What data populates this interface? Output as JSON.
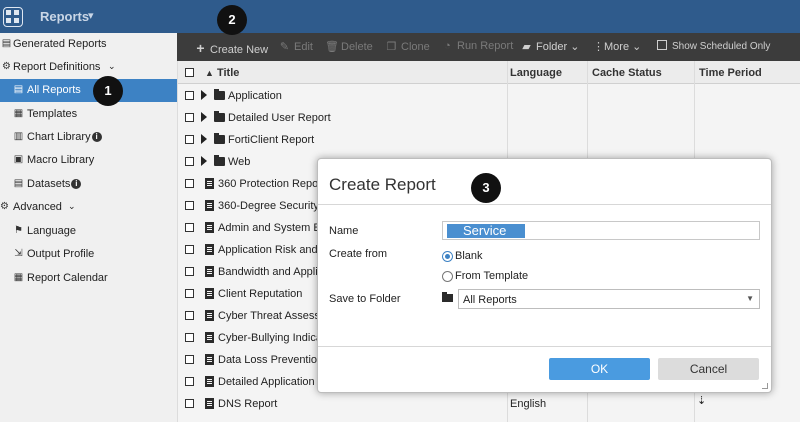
{
  "app": {
    "title": "Reports"
  },
  "colors": {
    "topbar": "#2f5b8c",
    "selected": "#3d82c4",
    "toolbar": "#3c3c3c",
    "ok_button": "#4a9be0"
  },
  "icons": {
    "apps": "grid-icon",
    "caret": "chevron-down-icon"
  },
  "sidebar": {
    "items": [
      {
        "label": "Generated Reports",
        "icon": "report-icon"
      },
      {
        "label": "Report Definitions",
        "icon": "gear-icon"
      },
      {
        "label": "All Reports",
        "icon": "file-icon"
      },
      {
        "label": "Templates",
        "icon": "template-icon"
      },
      {
        "label": "Chart Library",
        "icon": "chart-icon"
      },
      {
        "label": "Macro Library",
        "icon": "macro-icon"
      },
      {
        "label": "Datasets",
        "icon": "dataset-icon"
      },
      {
        "label": "Advanced",
        "icon": "gear-icon"
      },
      {
        "label": "Language",
        "icon": "flag-icon"
      },
      {
        "label": "Output Profile",
        "icon": "output-icon"
      },
      {
        "label": "Report Calendar",
        "icon": "calendar-icon"
      }
    ],
    "info_mark": "i"
  },
  "badges": {
    "one": "1",
    "two": "2",
    "three": "3"
  },
  "toolbar": {
    "create_new": "Create New",
    "edit": "Edit",
    "delete": "Delete",
    "clone": "Clone",
    "run_report": "Run Report",
    "folder": "Folder",
    "more": "More",
    "show_scheduled": "Show Scheduled Only"
  },
  "table": {
    "columns": [
      "Title",
      "Language",
      "Cache Status",
      "Time Period"
    ],
    "rows": [
      {
        "title": "Application",
        "type": "folder",
        "language": ""
      },
      {
        "title": "Detailed User Report",
        "type": "folder",
        "language": ""
      },
      {
        "title": "FortiClient Report",
        "type": "folder",
        "language": ""
      },
      {
        "title": "Web",
        "type": "folder",
        "language": ""
      },
      {
        "title": "360 Protection Repo",
        "type": "report",
        "language": ""
      },
      {
        "title": "360-Degree Security",
        "type": "report",
        "language": ""
      },
      {
        "title": "Admin and System Ev",
        "type": "report",
        "language": ""
      },
      {
        "title": "Application Risk and",
        "type": "report",
        "language": ""
      },
      {
        "title": "Bandwidth and Appli",
        "type": "report",
        "language": ""
      },
      {
        "title": "Client Reputation",
        "type": "report",
        "language": ""
      },
      {
        "title": "Cyber Threat Assessu",
        "type": "report",
        "language": ""
      },
      {
        "title": "Cyber-Bullying Indica",
        "type": "report",
        "language": ""
      },
      {
        "title": "Data Loss Prevention",
        "type": "report",
        "language": ""
      },
      {
        "title": "Detailed Application",
        "type": "report",
        "language": ""
      },
      {
        "title": "DNS Report",
        "type": "report",
        "language": "English"
      }
    ]
  },
  "modal": {
    "title": "Create Report",
    "name_label": "Name",
    "name_value": "Service",
    "create_from_label": "Create from",
    "option_blank": "Blank",
    "option_template": "From Template",
    "selected_option": "Blank",
    "save_folder_label": "Save to Folder",
    "folder_value": "All Reports",
    "ok": "OK",
    "cancel": "Cancel"
  }
}
